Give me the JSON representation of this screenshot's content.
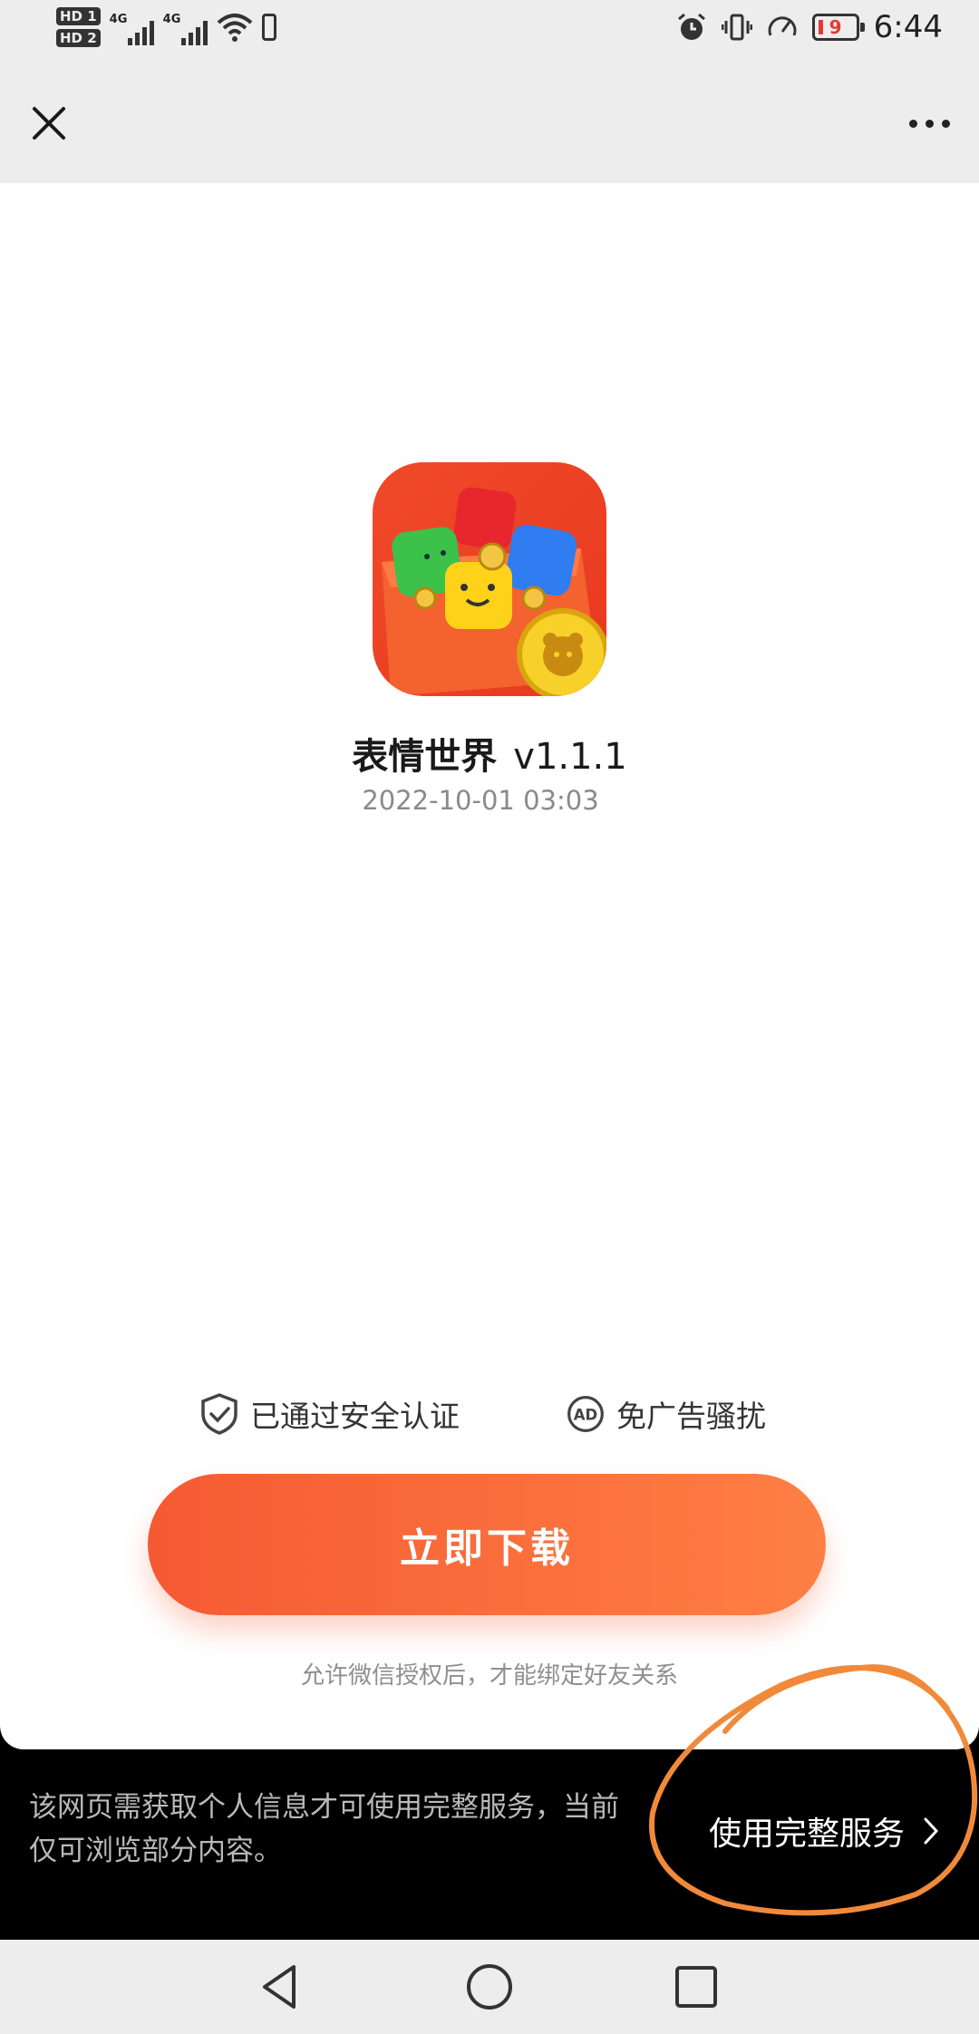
{
  "status_bar": {
    "sim1": "HD 1",
    "sim2": "HD 2",
    "network1": "4G",
    "network2": "4G",
    "battery_level": "9",
    "time": "6:44"
  },
  "header": {
    "close_icon": "close-icon",
    "more_icon": "more-dots-icon"
  },
  "app": {
    "name": "表情世界",
    "version": "v1.1.1",
    "date": "2022-10-01 03:03"
  },
  "badges": {
    "security": "已通过安全认证",
    "no_ads": "免广告骚扰"
  },
  "download_button": "立即下载",
  "auth_note": "允许微信授权后，才能绑定好友关系",
  "bottom_bar": {
    "message": "该网页需获取个人信息才可使用完整服务，当前仅可浏览部分内容。",
    "full_service_link": "使用完整服务"
  },
  "colors": {
    "accent_start": "#f55a32",
    "accent_end": "#ff7f45",
    "annotation": "#f08a3a",
    "battery_low": "#e53935"
  }
}
